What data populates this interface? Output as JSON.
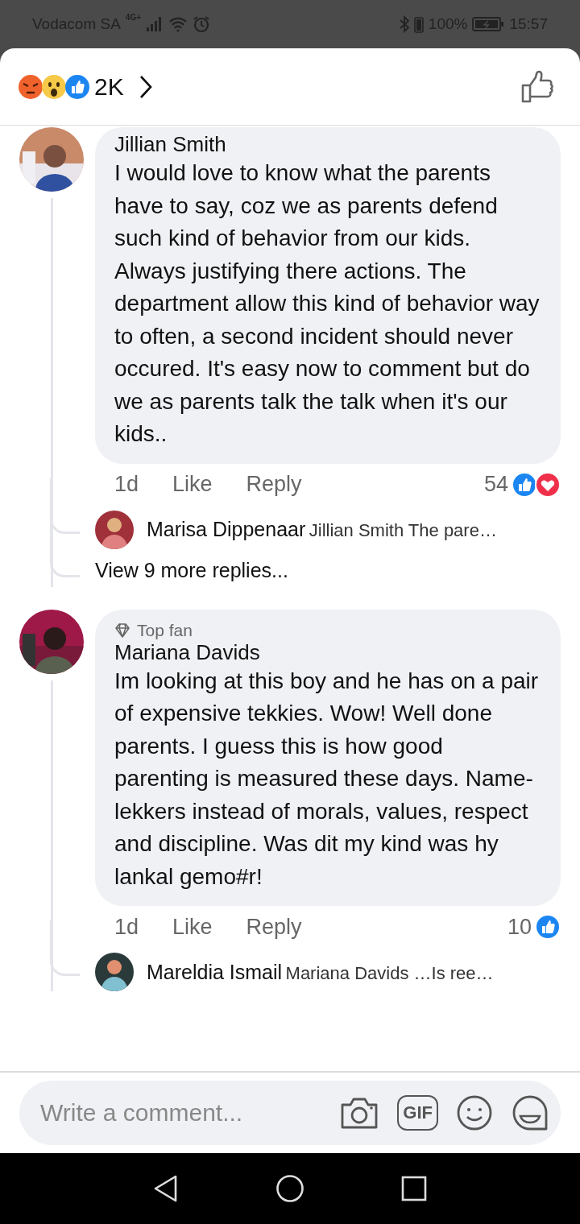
{
  "status_bar": {
    "carrier": "Vodacom SA",
    "network": "4G+",
    "battery": "100%",
    "time": "15:57"
  },
  "header": {
    "reactions": [
      {
        "kind": "angry"
      },
      {
        "kind": "wow"
      },
      {
        "kind": "like"
      }
    ],
    "reaction_count": "2K"
  },
  "comments": [
    {
      "author": "Jillian Smith",
      "text": "I would love to know what the parents have to say, coz we as parents defend such kind of behavior from our kids. Always justifying there actions. The department allow this kind of behavior way to often, a second incident should never occured. It's easy now to comment but do we as parents talk the talk when it's our kids..",
      "time": "1d",
      "like": "Like",
      "reply": "Reply",
      "reaction_count": "54",
      "reactions": [
        {
          "kind": "like"
        },
        {
          "kind": "love"
        }
      ],
      "replies": [
        {
          "author": "Marisa Dippenaar",
          "text": "Jillian Smith The pare…"
        }
      ],
      "more_replies": "View 9 more replies..."
    },
    {
      "badge": "Top fan",
      "author": "Mariana Davids",
      "text": "Im looking at this boy and he has on a pair of expensive tekkies. Wow! Well done parents. I guess this is how good parenting is measured these days. Name-lekkers instead of morals, values, respect and discipline. Was dit my kind was hy lankal gemo#r!",
      "time": "1d",
      "like": "Like",
      "reply": "Reply",
      "reaction_count": "10",
      "reactions": [
        {
          "kind": "like"
        }
      ],
      "replies": [
        {
          "author": "Mareldia Ismail",
          "text": "Mariana Davids …Is ree…"
        }
      ]
    }
  ],
  "composer": {
    "placeholder": "Write a comment...",
    "gif_label": "GIF"
  }
}
